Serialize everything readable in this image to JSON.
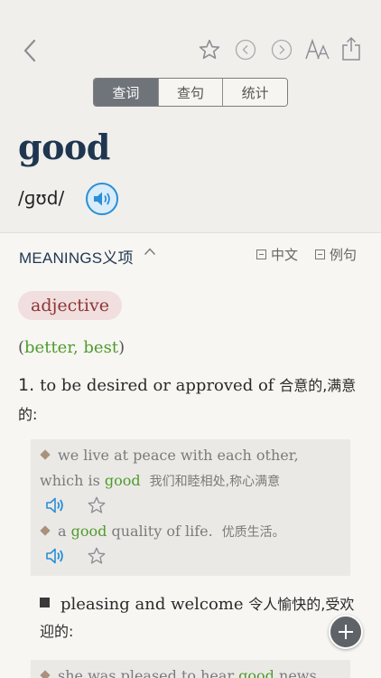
{
  "segments": [
    {
      "label": "查词",
      "active": true
    },
    {
      "label": "查句",
      "active": false
    },
    {
      "label": "统计",
      "active": false
    }
  ],
  "entry": {
    "headword": "good",
    "phonetic": "/ɡʊd/"
  },
  "meanings": {
    "title": "MEANINGS义项",
    "toggle_chinese": "中文",
    "toggle_examples": "例句"
  },
  "pos": "adjective",
  "forms": {
    "open": "(",
    "comparative": "better",
    "sep": ", ",
    "superlative": "best",
    "close": ")"
  },
  "sense1": {
    "number": "1.",
    "definition": "to be desired or approved of",
    "chinese": "合意的,满意的:"
  },
  "examples": [
    {
      "pre": "we live at peace with each other, which is ",
      "highlight": "good",
      "post": "",
      "chinese": "我们和睦相处,称心满意"
    },
    {
      "pre": "a ",
      "highlight": "good",
      "post": " quality of life.",
      "chinese": "优质生活。"
    }
  ],
  "subsense": {
    "definition": "pleasing and welcome",
    "chinese": "令人愉快的,受欢迎的:"
  },
  "example3": {
    "pre": "she was pleased to hear ",
    "highlight": "good",
    "post": " news"
  },
  "colors": {
    "accent_blue": "#2a8fd6",
    "headword": "#1f3650",
    "highlight_green": "#4f9b2d",
    "pos_badge": "#8c3535"
  },
  "icons": [
    "back-chevron-icon",
    "star-icon",
    "prev-circle-icon",
    "next-circle-icon",
    "font-size-icon",
    "share-icon",
    "speaker-icon",
    "plus-icon"
  ]
}
